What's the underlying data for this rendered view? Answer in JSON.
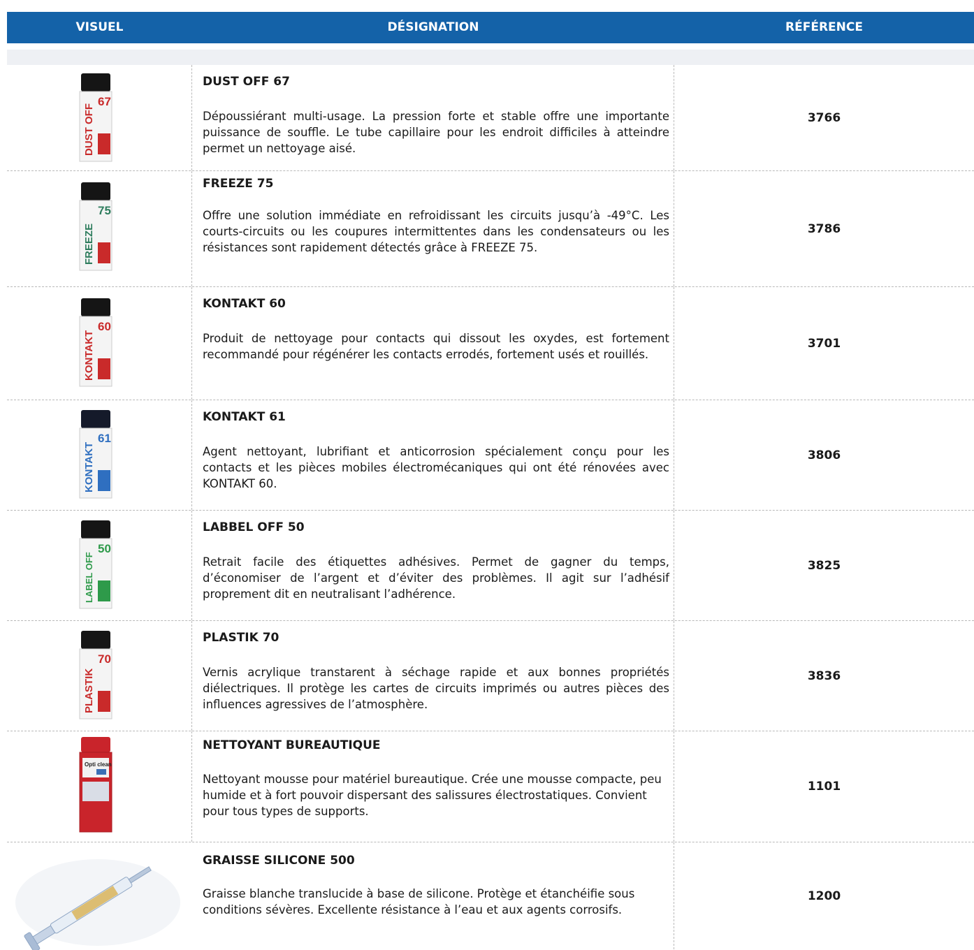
{
  "header": {
    "col_visuel": "VISUEL",
    "col_designation": "DÉSIGNATION",
    "col_reference": "RÉFÉRENCE"
  },
  "rows": [
    {
      "name": "DUST OFF 67",
      "description": "Dépoussiérant multi-usage. La pression forte et stable offre une importante puissance de souffle. Le tube capillaire pour les endroit difficiles à atteindre permet un nettoyage aisé.",
      "reference": "3766",
      "label": "DUST OFF",
      "number": "67",
      "band_color": "#c92a2a"
    },
    {
      "name": "FREEZE 75",
      "description": "Offre une solution immédiate en refroidissant les circuits jusqu’à -49°C. Les courts-circuits ou les coupures intermittentes dans les condensateurs ou les résistances sont rapidement détectés grâce à FREEZE 75.",
      "reference": "3786",
      "label": "FREEZE",
      "number": "75",
      "band_color": "#c92a2a"
    },
    {
      "name": "KONTAKT 60",
      "description": "Produit de nettoyage pour contacts qui dissout les oxydes, est fortement recommandé pour régénérer les contacts errodés, fortement usés et rouillés.",
      "reference": "3701",
      "label": "KONTAKT",
      "number": "60",
      "band_color": "#c92a2a"
    },
    {
      "name": "KONTAKT 61",
      "description": "Agent nettoyant, lubrifiant et anticorrosion spécialement conçu pour les contacts et les pièces mobiles électromécaniques qui ont été rénovées avec KONTAKT 60.",
      "reference": "3806",
      "label": "KONTAKT",
      "number": "61",
      "band_color": "#2f6fc0"
    },
    {
      "name": "LABBEL OFF 50",
      "description": "Retrait facile des étiquettes adhésives. Permet de gagner du temps, d’économiser de l’argent et d’éviter des problèmes. Il agit sur l’adhésif proprement dit en neutralisant l’adhérence.",
      "reference": "3825",
      "label": "LABEL OFF",
      "number": "50",
      "band_color": "#2e9a4a"
    },
    {
      "name": "PLASTIK 70",
      "description": "Vernis acrylique transtarent à séchage rapide et aux bonnes propriétés diélectriques. Il protège les cartes de circuits imprimés ou autres pièces des influences agressives de l’atmosphère.",
      "reference": "3836",
      "label": "PLASTIK",
      "number": "70",
      "band_color": "#c92a2a"
    },
    {
      "name": "NETTOYANT BUREAUTIQUE",
      "description": "Nettoyant mousse pour matériel bureautique. Crée une mousse compacte, peu humide et à fort pouvoir dispersant des salissures électrostatiques. Convient pour tous types de supports.",
      "reference": "1101",
      "label": "Opti clean",
      "number": "",
      "band_color": "#c9242b"
    },
    {
      "name": "GRAISSE SILICONE 500",
      "description": "Graisse blanche translucide à base de silicone. Protège et étanchéifie sous conditions sévères. Excellente résistance à l’eau et aux agents corrosifs.",
      "reference": "1200",
      "label": "",
      "number": "",
      "band_color": "#d9b45a"
    }
  ]
}
